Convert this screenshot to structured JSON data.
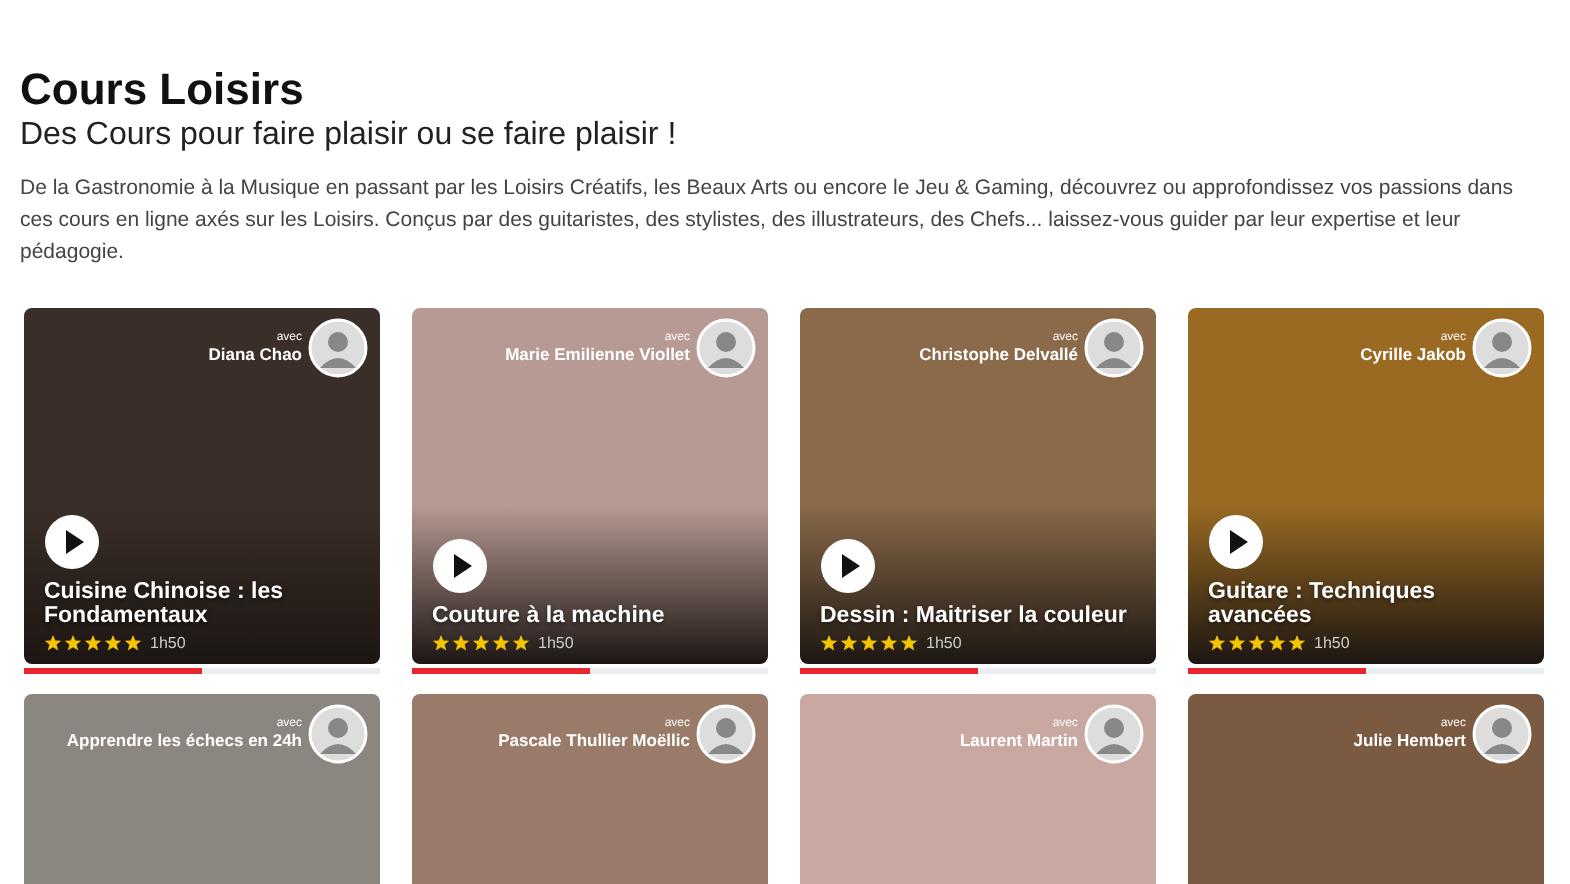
{
  "header": {
    "title": "Cours Loisirs",
    "subtitle": "Des Cours pour faire plaisir ou se faire plaisir !",
    "description": "De la Gastronomie à la Musique en passant par les Loisirs Créatifs, les Beaux Arts ou encore le Jeu & Gaming, découvrez ou approfondissez vos passions dans ces cours en ligne axés sur les Loisirs. Conçus par des guitaristes, des stylistes, des illustrateurs, des Chefs... laissez-vous guider par leur expertise et leur pédagogie."
  },
  "courses": [
    {
      "with": "avec",
      "instructor": "Diana Chao",
      "title": "Cuisine Chinoise : les Fondamentaux",
      "stars": 5,
      "duration": "1h50",
      "level": 0.5,
      "color": "#3a2e28"
    },
    {
      "with": "avec",
      "instructor": "Marie Emilienne Viollet",
      "title": "Couture à la machine",
      "stars": 5,
      "duration": "1h50",
      "level": 0.5,
      "color": "#b89a94"
    },
    {
      "with": "avec",
      "instructor": "Christophe Delvallé",
      "title": "Dessin : Maitriser la couleur",
      "stars": 5,
      "duration": "1h50",
      "level": 0.5,
      "color": "#8a6a48"
    },
    {
      "with": "avec",
      "instructor": "Cyrille Jakob",
      "title": "Guitare : Techniques avancées",
      "stars": 5,
      "duration": "1h50",
      "level": 0.5,
      "color": "#9a6a22"
    },
    {
      "with": "avec",
      "instructor": "Apprendre les échecs en 24h",
      "color": "#8c8680"
    },
    {
      "with": "avec",
      "instructor": "Pascale Thullier Moëllic",
      "color": "#9a7a68"
    },
    {
      "with": "avec",
      "instructor": "Laurent Martin",
      "color": "#c8a8a0"
    },
    {
      "with": "avec",
      "instructor": "Julie Hembert",
      "color": "#7a5a40"
    }
  ]
}
